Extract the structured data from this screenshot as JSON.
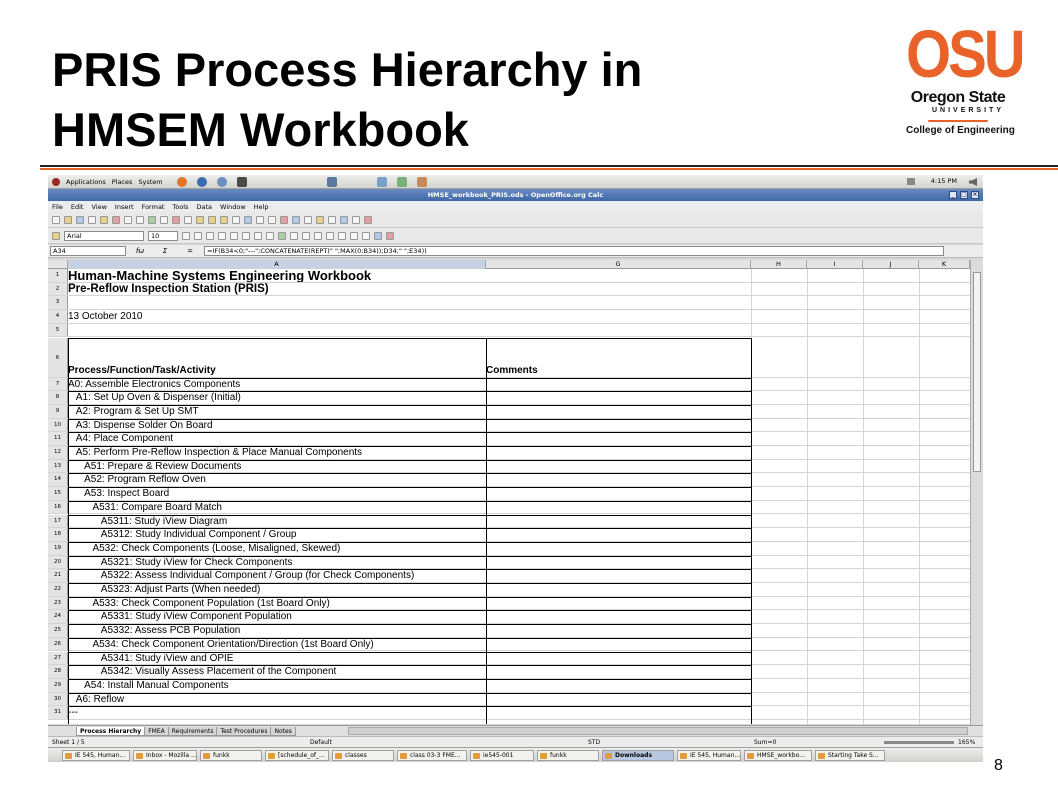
{
  "slide": {
    "title_line1": "PRIS Process Hierarchy in",
    "title_line2": "HMSEM Workbook",
    "page_number": "8",
    "logo": {
      "mark": "OSU",
      "name": "Oregon State",
      "university": "UNIVERSITY",
      "college": "College of Engineering",
      "color": "#e8622a"
    }
  },
  "desktop_panel": {
    "menus": [
      "Applications",
      "Places",
      "System"
    ],
    "clock": "4:15 PM"
  },
  "window": {
    "title": "HMSE_workbook_PRIS.ods - OpenOffice.org Calc"
  },
  "menubar": [
    "File",
    "Edit",
    "View",
    "Insert",
    "Format",
    "Tools",
    "Data",
    "Window",
    "Help"
  ],
  "formatting": {
    "font_name": "Arial",
    "font_size": "10"
  },
  "formula_bar": {
    "cell_ref": "A34",
    "fx_label": "fω",
    "sum_label": "Σ",
    "equals_label": "=",
    "formula": "=IF(B34<0;\"---\";CONCATENATE(REPT(\"   \";MAX(0;B34));D34;\" \";E34))"
  },
  "columns": [
    "A",
    "G",
    "H",
    "I",
    "J",
    "K"
  ],
  "rows": [
    {
      "num": "1",
      "a": "Human-Machine Systems Engineering Workbook",
      "g": "",
      "style": "title"
    },
    {
      "num": "2",
      "a": "Pre-Reflow Inspection Station (PRIS)",
      "g": "",
      "style": "subtitle"
    },
    {
      "num": "3",
      "a": "",
      "g": "",
      "style": "normal"
    },
    {
      "num": "4",
      "a": "13 October 2010",
      "g": "",
      "style": "normal"
    },
    {
      "num": "5",
      "a": "",
      "g": "",
      "style": "normal"
    },
    {
      "num": "6",
      "a": "Process/Function/Task/Activity",
      "g": "Comments",
      "style": "header"
    },
    {
      "num": "7",
      "a": "A0: Assemble Electronics Components",
      "g": "",
      "style": "normal"
    },
    {
      "num": "8",
      "a": "   A1: Set Up Oven & Dispenser (Initial)",
      "g": "",
      "style": "normal"
    },
    {
      "num": "9",
      "a": "   A2: Program & Set Up SMT",
      "g": "",
      "style": "normal"
    },
    {
      "num": "10",
      "a": "   A3: Dispense Solder On Board",
      "g": "",
      "style": "normal"
    },
    {
      "num": "11",
      "a": "   A4: Place Component",
      "g": "",
      "style": "normal"
    },
    {
      "num": "12",
      "a": "   A5: Perform Pre-Reflow Inspection & Place Manual Components",
      "g": "",
      "style": "normal"
    },
    {
      "num": "13",
      "a": "      A51: Prepare & Review Documents",
      "g": "",
      "style": "normal"
    },
    {
      "num": "14",
      "a": "      A52: Program Reflow Oven",
      "g": "",
      "style": "normal"
    },
    {
      "num": "15",
      "a": "      A53: Inspect Board",
      "g": "",
      "style": "normal"
    },
    {
      "num": "16",
      "a": "         A531: Compare Board Match",
      "g": "",
      "style": "normal"
    },
    {
      "num": "17",
      "a": "            A5311: Study iView Diagram",
      "g": "",
      "style": "normal"
    },
    {
      "num": "18",
      "a": "            A5312: Study Individual Component / Group",
      "g": "",
      "style": "normal"
    },
    {
      "num": "19",
      "a": "         A532: Check Components (Loose, Misaligned, Skewed)",
      "g": "",
      "style": "normal"
    },
    {
      "num": "20",
      "a": "            A5321: Study iView for Check Components",
      "g": "",
      "style": "normal"
    },
    {
      "num": "21",
      "a": "            A5322: Assess Individual Component / Group (for Check Components)",
      "g": "",
      "style": "normal"
    },
    {
      "num": "22",
      "a": "            A5323: Adjust Parts (When needed)",
      "g": "",
      "style": "normal"
    },
    {
      "num": "23",
      "a": "         A533: Check Component Population (1st Board Only)",
      "g": "",
      "style": "normal"
    },
    {
      "num": "24",
      "a": "            A5331: Study iView Component Population",
      "g": "",
      "style": "normal"
    },
    {
      "num": "25",
      "a": "            A5332: Assess PCB Population",
      "g": "",
      "style": "normal"
    },
    {
      "num": "26",
      "a": "         A534: Check Component Orientation/Direction (1st Board Only)",
      "g": "",
      "style": "normal"
    },
    {
      "num": "27",
      "a": "            A5341: Study iView and OPIE",
      "g": "",
      "style": "normal"
    },
    {
      "num": "28",
      "a": "            A5342: Visually Assess Placement of the Component",
      "g": "",
      "style": "normal"
    },
    {
      "num": "29",
      "a": "      A54: Install Manual Components",
      "g": "",
      "style": "normal"
    },
    {
      "num": "30",
      "a": "   A6: Reflow",
      "g": "",
      "style": "normal"
    },
    {
      "num": "31",
      "a": "---",
      "g": "",
      "style": "normal"
    }
  ],
  "sheet_tabs": [
    "Process Hierarchy",
    "FMEA",
    "Requirements",
    "Test Procedures",
    "Notes"
  ],
  "status": {
    "sheet": "Sheet 1 / 5",
    "page_style": "Default",
    "mode": "STD",
    "sum": "Sum=0",
    "zoom": "165%"
  },
  "taskbar": [
    {
      "label": "IE 545, Human...",
      "active": false
    },
    {
      "label": "Inbox - Mozilla ...",
      "active": false
    },
    {
      "label": "funkk",
      "active": false
    },
    {
      "label": "[schedule_of_...",
      "active": false
    },
    {
      "label": "classes",
      "active": false
    },
    {
      "label": "class 03-3 FME...",
      "active": false
    },
    {
      "label": "ie545-001",
      "active": false
    },
    {
      "label": "funkk",
      "active": false
    },
    {
      "label": "Downloads",
      "active": true
    },
    {
      "label": "IE 545, Human...",
      "active": false
    },
    {
      "label": "HMSE_workbo...",
      "active": false
    },
    {
      "label": "Starting Take S...",
      "active": false
    }
  ]
}
